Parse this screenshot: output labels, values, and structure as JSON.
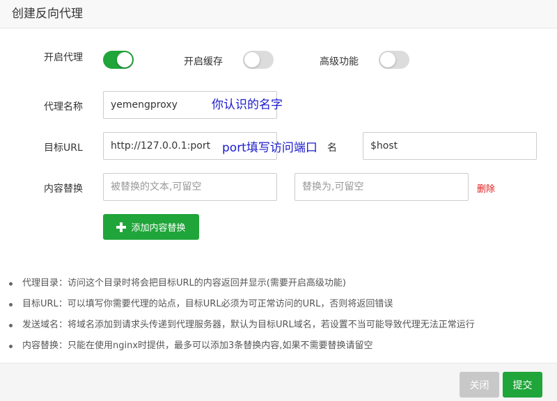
{
  "dialog": {
    "title": "创建反向代理"
  },
  "form": {
    "enable_proxy_label": "开启代理",
    "enable_proxy": true,
    "enable_cache_label": "开启缓存",
    "enable_cache": false,
    "advanced_label": "高级功能",
    "advanced": false,
    "proxy_name_label": "代理名称",
    "proxy_name_value": "yemengproxy",
    "target_url_label": "目标URL",
    "target_url_value": "http://127.0.0.1:port",
    "send_domain_label": "名",
    "send_domain_value": "$host",
    "content_replace_label": "内容替换",
    "replace_from_placeholder": "被替换的文本,可留空",
    "replace_to_placeholder": "替换为,可留空",
    "delete_label": "删除",
    "add_replace_button": "添加内容替换"
  },
  "annotations": {
    "name_hint": "你认识的名字",
    "port_hint": "port填写访问端口"
  },
  "notes": [
    "代理目录：访问这个目录时将会把目标URL的内容返回并显示(需要开启高级功能)",
    "目标URL：可以填写你需要代理的站点，目标URL必须为可正常访问的URL，否则将返回错误",
    "发送域名：将域名添加到请求头传递到代理服务器，默认为目标URL域名，若设置不当可能导致代理无法正常运行",
    "内容替换：只能在使用nginx时提供，最多可以添加3条替换内容,如果不需要替换请留空"
  ],
  "footer": {
    "close_label": "关闭",
    "submit_label": "提交"
  },
  "colors": {
    "accent": "#20a53a",
    "toggle_off": "#dcdcdc",
    "danger": "#e01a1a",
    "annotation": "#1a1acc"
  }
}
